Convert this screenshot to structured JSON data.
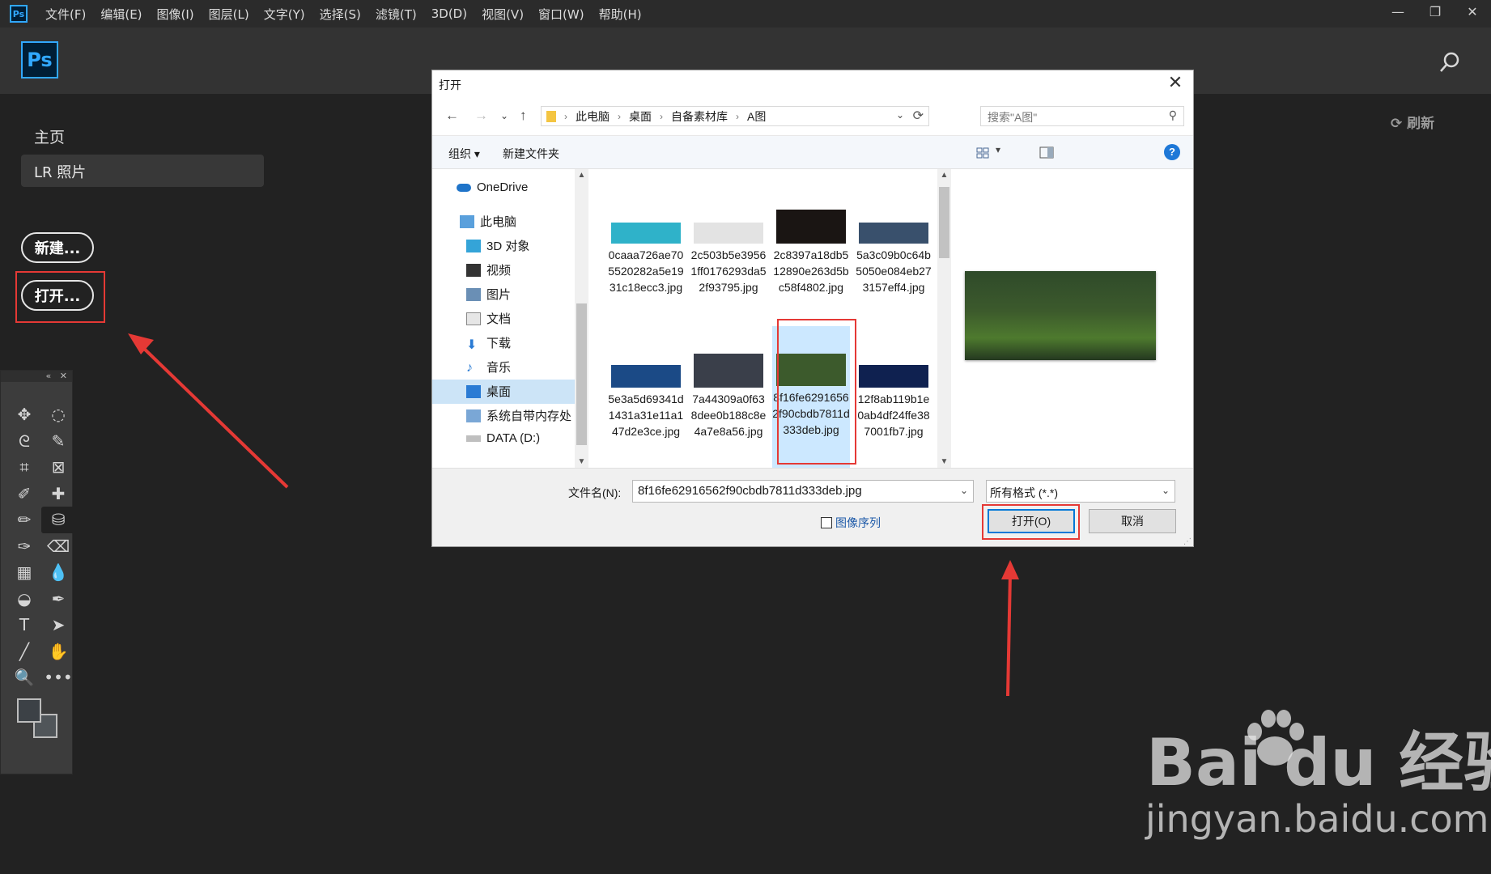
{
  "app": {
    "badge": "Ps",
    "menus": [
      "文件(F)",
      "编辑(E)",
      "图像(I)",
      "图层(L)",
      "文字(Y)",
      "选择(S)",
      "滤镜(T)",
      "3D(D)",
      "视图(V)",
      "窗口(W)",
      "帮助(H)"
    ],
    "window_controls": [
      "—",
      "❐",
      "✕"
    ]
  },
  "home": {
    "logo": "Ps",
    "nav_home": "主页",
    "nav_lr": "LR 照片",
    "new_button": "新建...",
    "open_button": "打开...",
    "refresh_label": "刷新"
  },
  "toolbox": {
    "collapse": "«",
    "close": "✕",
    "tools": [
      "✥",
      "◌",
      "ᘓ",
      "✎",
      "⌗",
      "⊠",
      "✐",
      "✚",
      "✏",
      "⛁",
      "✑",
      "⌫",
      "▦",
      "💧",
      "◒",
      "✒",
      "T",
      "➤",
      "╱",
      "✋",
      "🔍",
      "•••"
    ]
  },
  "dialog": {
    "title": "打开",
    "close": "✕",
    "breadcrumbs": [
      "此电脑",
      "桌面",
      "自备素材库",
      "A图"
    ],
    "search_placeholder": "搜索\"A图\"",
    "organize": "组织 ▾",
    "new_folder": "新建文件夹",
    "help": "?",
    "nav_items": [
      {
        "label": "OneDrive",
        "icon": "cloud-icon"
      },
      {
        "label": "此电脑",
        "icon": "computer-icon"
      },
      {
        "label": "3D 对象",
        "icon": "cube-icon"
      },
      {
        "label": "视频",
        "icon": "video-icon"
      },
      {
        "label": "图片",
        "icon": "picture-icon"
      },
      {
        "label": "文档",
        "icon": "document-icon"
      },
      {
        "label": "下载",
        "icon": "download-icon"
      },
      {
        "label": "音乐",
        "icon": "music-icon"
      },
      {
        "label": "桌面",
        "icon": "desktop-icon"
      },
      {
        "label": "系统自带内存处",
        "icon": "drive-icon"
      },
      {
        "label": "DATA (D:)",
        "icon": "drive-icon"
      }
    ],
    "files": [
      {
        "name": "0caaa726ae705520282a5e1931c18ecc3.jpg",
        "color": "#2fb2c9"
      },
      {
        "name": "2c503b5e39561ff0176293da52f93795.jpg",
        "color": "#e3e3e3"
      },
      {
        "name": "2c8397a18db512890e263d5bc58f4802.jpg",
        "color": "#1a1513"
      },
      {
        "name": "5a3c09b0c64b5050e084eb273157eff4.jpg",
        "color": "#39506c"
      },
      {
        "name": "5e3a5d69341d1431a31e11a147d2e3ce.jpg",
        "color": "#1b4a86"
      },
      {
        "name": "7a44309a0f638dee0b188c8e4a7e8a56.jpg",
        "color": "#3a3f4a"
      },
      {
        "name": "8f16fe62916562f90cbdb7811d333deb.jpg",
        "color": "#3c5a2c"
      },
      {
        "name": "12f8ab119b1e0ab4df24ffe387001fb7.jpg",
        "color": "#0f2150"
      }
    ],
    "filename_label": "文件名(N):",
    "filename_value": "8f16fe62916562f90cbdb7811d333deb.jpg",
    "filetype": "所有格式 (*.*)",
    "image_sequence": "图像序列",
    "open_button": "打开(O)",
    "cancel_button": "取消"
  },
  "watermark": {
    "brand": "Bai du 经验",
    "url": "jingyan.baidu.com"
  },
  "colors": {
    "accent": "#31a8ff",
    "highlight": "#e53935",
    "selection": "#cce8ff"
  }
}
